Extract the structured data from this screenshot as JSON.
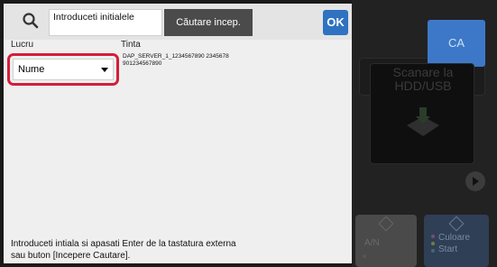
{
  "search": {
    "input_text": "Introduceti initialele",
    "button_label": "Căutare incep.",
    "ok_label": "OK"
  },
  "columns": {
    "work": "Lucru",
    "target": "Tinta"
  },
  "work_dropdown": {
    "selected": "Nume"
  },
  "target_value": "DAP_SERVER_1_1234567890 2345678901234567890",
  "hint": "Introduceti intiala si apasati Enter de la tastatura externa sau buton  [Incepere Cautare].",
  "background": {
    "ca_label": "CA",
    "scan_label": "Scanare la HDD/USB",
    "bw_label": "A/N",
    "color_label": "Culoare",
    "start_label": "Start"
  },
  "colors": {
    "highlight": "#d41e3a",
    "ok_button": "#2e72c0",
    "search_button": "#4b4b4b"
  }
}
